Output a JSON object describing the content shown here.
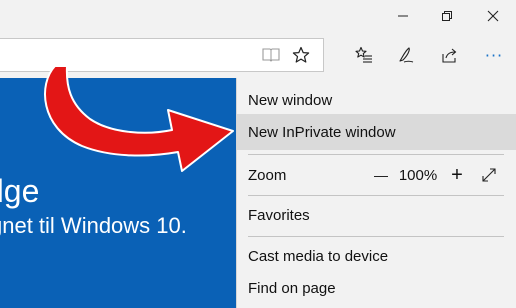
{
  "menu": {
    "new_window": "New window",
    "new_inprivate_window": "New InPrivate window",
    "zoom_label": "Zoom",
    "zoom_value": "100%",
    "zoom_out_symbol": "—",
    "zoom_in_symbol": "+",
    "favorites": "Favorites",
    "cast_media": "Cast media to device",
    "find_on_page": "Find on page"
  },
  "page": {
    "hero_title": "dge",
    "hero_subtitle": "gnet til Windows 10."
  },
  "toolbar": {
    "more_label": "···"
  },
  "icons": {
    "minimize": "minimize-icon",
    "restore": "restore-icon",
    "close": "close-icon",
    "reading_view": "reading-view-icon",
    "favorite": "star-icon",
    "favorites_hub": "hub-icon",
    "web_note": "pen-icon",
    "share": "share-icon",
    "more": "more-icon",
    "fullscreen": "fullscreen-icon"
  },
  "colors": {
    "page_blue": "#0a61b6",
    "arrow_red": "#e31616",
    "accent": "#1a73c8",
    "menu_highlight": "#dadada"
  }
}
